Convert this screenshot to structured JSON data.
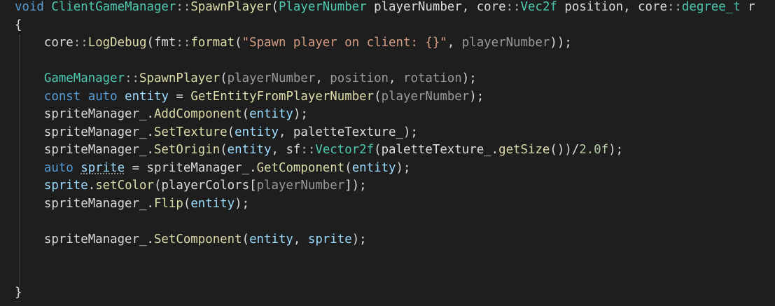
{
  "colors": {
    "background": "#1e1e1e",
    "plain": "#dcdcdc",
    "keyword": "#569cd6",
    "type": "#4ec9b0",
    "function": "#dcdcaa",
    "string": "#d69d85",
    "variable": "#9cdcfe",
    "member": "#dadada",
    "number": "#b5cea8",
    "punctuation": "#b4b4b4",
    "parameter": "#9a9a9a"
  },
  "code": {
    "lines": [
      [
        {
          "t": "void",
          "c": "keyword"
        },
        {
          "t": " ",
          "c": "plain"
        },
        {
          "t": "ClientGameManager",
          "c": "type"
        },
        {
          "t": "::",
          "c": "punctuation"
        },
        {
          "t": "SpawnPlayer",
          "c": "function"
        },
        {
          "t": "(",
          "c": "plain"
        },
        {
          "t": "PlayerNumber",
          "c": "type"
        },
        {
          "t": " playerNumber, ",
          "c": "plain"
        },
        {
          "t": "core",
          "c": "plain"
        },
        {
          "t": "::",
          "c": "punctuation"
        },
        {
          "t": "Vec2f",
          "c": "type"
        },
        {
          "t": " position, ",
          "c": "plain"
        },
        {
          "t": "core",
          "c": "plain"
        },
        {
          "t": "::",
          "c": "punctuation"
        },
        {
          "t": "degree_t",
          "c": "type"
        },
        {
          "t": " r",
          "c": "plain"
        }
      ],
      [
        {
          "t": "{",
          "c": "plain"
        }
      ],
      [
        {
          "t": "    core",
          "c": "plain"
        },
        {
          "t": "::",
          "c": "punctuation"
        },
        {
          "t": "LogDebug",
          "c": "function"
        },
        {
          "t": "(fmt",
          "c": "plain"
        },
        {
          "t": "::",
          "c": "punctuation"
        },
        {
          "t": "format",
          "c": "function"
        },
        {
          "t": "(",
          "c": "plain"
        },
        {
          "t": "\"Spawn player on client: {}\"",
          "c": "string"
        },
        {
          "t": ", ",
          "c": "plain"
        },
        {
          "t": "playerNumber",
          "c": "parameter"
        },
        {
          "t": "));",
          "c": "plain"
        }
      ],
      [],
      [
        {
          "t": "    ",
          "c": "plain"
        },
        {
          "t": "GameManager",
          "c": "type"
        },
        {
          "t": "::",
          "c": "punctuation"
        },
        {
          "t": "SpawnPlayer",
          "c": "function"
        },
        {
          "t": "(",
          "c": "plain"
        },
        {
          "t": "playerNumber",
          "c": "parameter"
        },
        {
          "t": ", ",
          "c": "plain"
        },
        {
          "t": "position",
          "c": "parameter"
        },
        {
          "t": ", ",
          "c": "plain"
        },
        {
          "t": "rotation",
          "c": "parameter"
        },
        {
          "t": ");",
          "c": "plain"
        }
      ],
      [
        {
          "t": "    ",
          "c": "plain"
        },
        {
          "t": "const",
          "c": "keyword"
        },
        {
          "t": " ",
          "c": "plain"
        },
        {
          "t": "auto",
          "c": "keyword"
        },
        {
          "t": " ",
          "c": "plain"
        },
        {
          "t": "entity",
          "c": "variable"
        },
        {
          "t": " = ",
          "c": "plain"
        },
        {
          "t": "GetEntityFromPlayerNumber",
          "c": "function"
        },
        {
          "t": "(",
          "c": "plain"
        },
        {
          "t": "playerNumber",
          "c": "parameter"
        },
        {
          "t": ");",
          "c": "plain"
        }
      ],
      [
        {
          "t": "    spriteManager_",
          "c": "member"
        },
        {
          "t": ".",
          "c": "plain"
        },
        {
          "t": "AddComponent",
          "c": "function"
        },
        {
          "t": "(",
          "c": "plain"
        },
        {
          "t": "entity",
          "c": "variable"
        },
        {
          "t": ");",
          "c": "plain"
        }
      ],
      [
        {
          "t": "    spriteManager_",
          "c": "member"
        },
        {
          "t": ".",
          "c": "plain"
        },
        {
          "t": "SetTexture",
          "c": "function"
        },
        {
          "t": "(",
          "c": "plain"
        },
        {
          "t": "entity",
          "c": "variable"
        },
        {
          "t": ", paletteTexture_);",
          "c": "plain"
        }
      ],
      [
        {
          "t": "    spriteManager_",
          "c": "member"
        },
        {
          "t": ".",
          "c": "plain"
        },
        {
          "t": "SetOrigin",
          "c": "function"
        },
        {
          "t": "(",
          "c": "plain"
        },
        {
          "t": "entity",
          "c": "variable"
        },
        {
          "t": ", sf",
          "c": "plain"
        },
        {
          "t": "::",
          "c": "punctuation"
        },
        {
          "t": "Vector2f",
          "c": "type"
        },
        {
          "t": "(paletteTexture_.",
          "c": "plain"
        },
        {
          "t": "getSize",
          "c": "function"
        },
        {
          "t": "())/",
          "c": "plain"
        },
        {
          "t": "2.0f",
          "c": "number"
        },
        {
          "t": ");",
          "c": "plain"
        }
      ],
      [
        {
          "t": "    ",
          "c": "plain"
        },
        {
          "t": "auto",
          "c": "keyword"
        },
        {
          "t": " ",
          "c": "plain"
        },
        {
          "t": "sprite",
          "c": "variable",
          "u": true
        },
        {
          "t": " = spriteManager_.",
          "c": "plain"
        },
        {
          "t": "GetComponent",
          "c": "function"
        },
        {
          "t": "(",
          "c": "plain"
        },
        {
          "t": "entity",
          "c": "variable"
        },
        {
          "t": ");",
          "c": "plain"
        }
      ],
      [
        {
          "t": "    ",
          "c": "plain"
        },
        {
          "t": "sprite",
          "c": "variable"
        },
        {
          "t": ".",
          "c": "plain"
        },
        {
          "t": "setColor",
          "c": "function"
        },
        {
          "t": "(playerColors[",
          "c": "plain"
        },
        {
          "t": "playerNumber",
          "c": "parameter"
        },
        {
          "t": "]);",
          "c": "plain"
        }
      ],
      [
        {
          "t": "    spriteManager_",
          "c": "member"
        },
        {
          "t": ".",
          "c": "plain"
        },
        {
          "t": "Flip",
          "c": "function"
        },
        {
          "t": "(",
          "c": "plain"
        },
        {
          "t": "entity",
          "c": "variable"
        },
        {
          "t": ");",
          "c": "plain"
        }
      ],
      [],
      [
        {
          "t": "    spriteManager_",
          "c": "member"
        },
        {
          "t": ".",
          "c": "plain"
        },
        {
          "t": "SetComponent",
          "c": "function"
        },
        {
          "t": "(",
          "c": "plain"
        },
        {
          "t": "entity",
          "c": "variable"
        },
        {
          "t": ", ",
          "c": "plain"
        },
        {
          "t": "sprite",
          "c": "variable"
        },
        {
          "t": ");",
          "c": "plain"
        }
      ],
      [],
      [],
      [
        {
          "t": "}",
          "c": "plain"
        }
      ]
    ]
  }
}
